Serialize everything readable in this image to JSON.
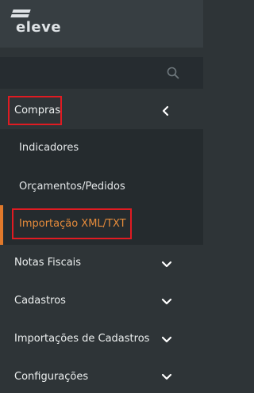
{
  "app": {
    "logo_text": "eleve"
  },
  "search": {
    "icon": "search-icon"
  },
  "menu": {
    "compras": {
      "label": "Compras",
      "expanded": true,
      "icon": "chevron-left-icon"
    },
    "compras_sub": [
      {
        "label": "Indicadores",
        "active": false
      },
      {
        "label": "Orçamentos/Pedidos",
        "active": false
      },
      {
        "label": "Importação XML/TXT",
        "active": true
      }
    ],
    "items": [
      {
        "label": "Notas Fiscais",
        "icon": "chevron-down-icon"
      },
      {
        "label": "Cadastros",
        "icon": "chevron-down-icon"
      },
      {
        "label": "Importações de Cadastros",
        "icon": "chevron-down-icon"
      },
      {
        "label": "Configurações",
        "icon": "chevron-down-icon"
      }
    ]
  },
  "colors": {
    "background": "#2e3437",
    "submenu_background": "#252b2e",
    "active_text": "#e58b3b",
    "highlight_box": "#e01b22"
  }
}
